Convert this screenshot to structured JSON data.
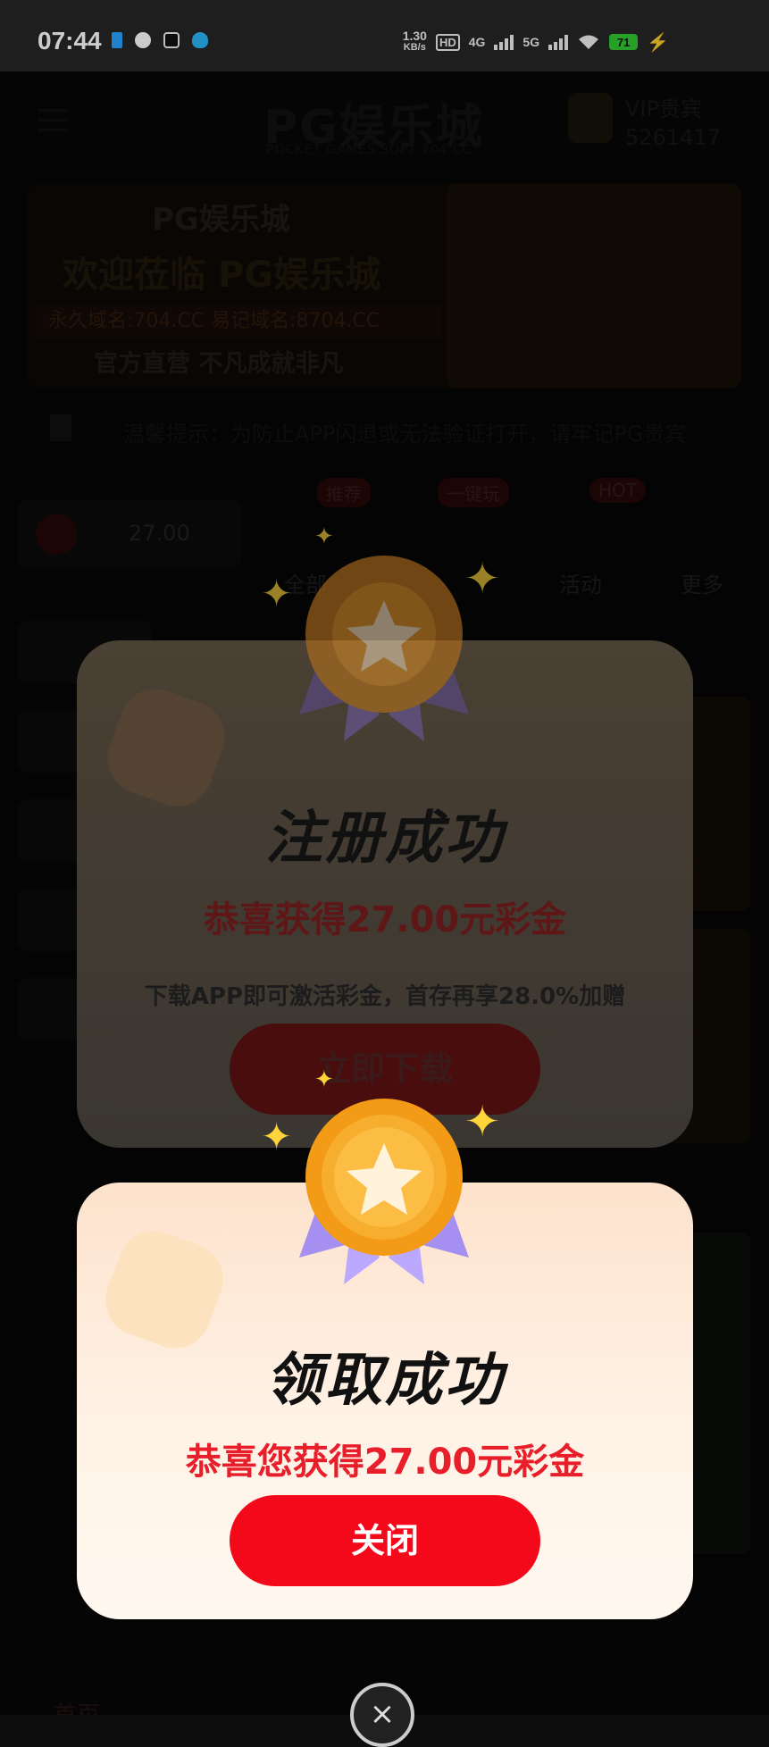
{
  "status_bar": {
    "time": "07:44",
    "net_speed_value": "1.30",
    "net_speed_unit": "KB/s",
    "hd": "HD",
    "sim1": "4G",
    "sim2": "5G",
    "battery": "71"
  },
  "background": {
    "logo": "PG娱乐城",
    "logo_sub": "POCKET GAMES SOFT 704.CC",
    "vip_label": "VIP贵宾",
    "vip_id": "5261417",
    "banner_logo": "PG娱乐城",
    "banner_title": "欢迎莅临 PG娱乐城",
    "banner_domains": "永久域名:704.CC  易记域名:8704.CC",
    "banner_slogan": "官方直营 不凡成就非凡",
    "notice": "温馨提示：为防止APP闪退或无法验证打开，请牢记PG贵宾",
    "balance": "27.00",
    "nav_all": "全部",
    "nav_activity": "活动",
    "nav_more": "更多",
    "badge_hot": "HOT",
    "badge_1": "推荐",
    "badge_2": "一键玩",
    "home_label": "首页"
  },
  "modal_register": {
    "title": "注册成功",
    "subtitle": "恭喜获得27.00元彩金",
    "description": "下载APP即可激活彩金，首存再享28.0%加赠",
    "button": "立即下载"
  },
  "modal_claim": {
    "title": "领取成功",
    "subtitle": "恭喜您获得27.00元彩金",
    "button": "关闭"
  },
  "close_icon": "×"
}
